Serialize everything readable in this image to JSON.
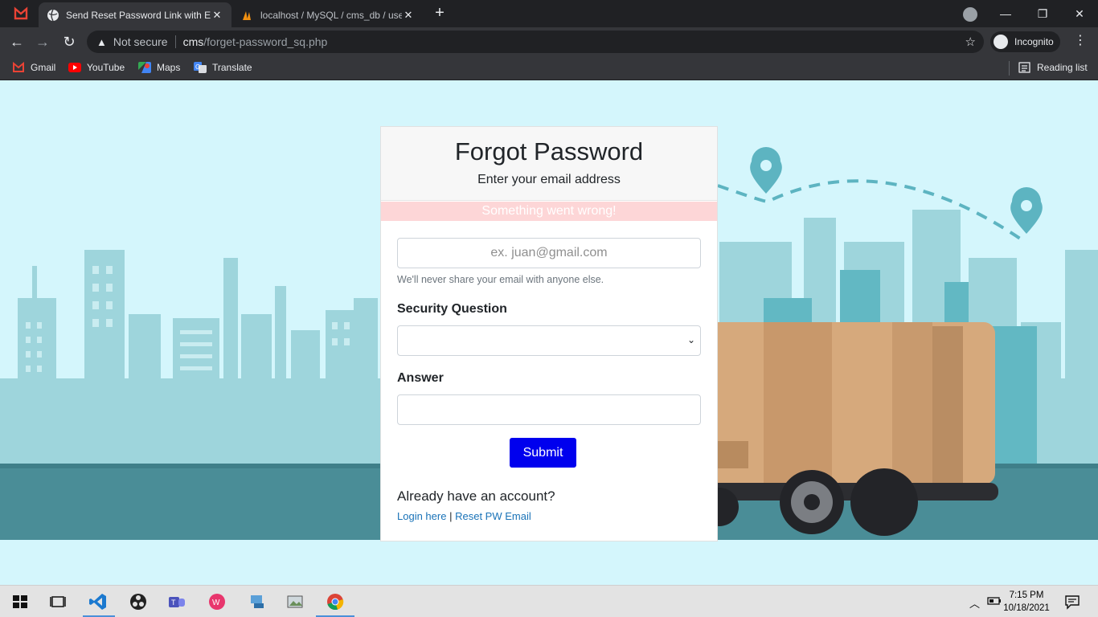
{
  "browser": {
    "tabs": [
      {
        "label": "Send Reset Password Link with Em",
        "active": true
      },
      {
        "label": "localhost / MySQL / cms_db / use",
        "active": false
      }
    ],
    "security_label": "Not secure",
    "url_host": "cms",
    "url_path": "/forget-password_sq.php",
    "incognito_label": "Incognito",
    "bookmarks": [
      {
        "label": "Gmail",
        "icon": "gmail-icon"
      },
      {
        "label": "YouTube",
        "icon": "youtube-icon"
      },
      {
        "label": "Maps",
        "icon": "maps-icon"
      },
      {
        "label": "Translate",
        "icon": "translate-icon"
      }
    ],
    "reading_list": "Reading list"
  },
  "form": {
    "title": "Forgot Password",
    "subtitle": "Enter your email address",
    "alert": "Something went wrong!",
    "email_placeholder": "ex. juan@gmail.com",
    "email_help": "We'll never share your email with anyone else.",
    "security_question_label": "Security Question",
    "security_question_value": "",
    "answer_label": "Answer",
    "answer_value": "",
    "submit_label": "Submit",
    "already_text": "Already have an account?",
    "login_link": "Login here",
    "link_separator": "|",
    "reset_link": "Reset PW Email"
  },
  "taskbar": {
    "time": "7:15 PM",
    "date": "10/18/2021"
  },
  "colors": {
    "page_bg": "#d4f6fc",
    "submit_bg": "#0000ee",
    "alert_bg": "#fdd6d7",
    "link": "#1a73b8",
    "ground": "#4a8d97"
  }
}
